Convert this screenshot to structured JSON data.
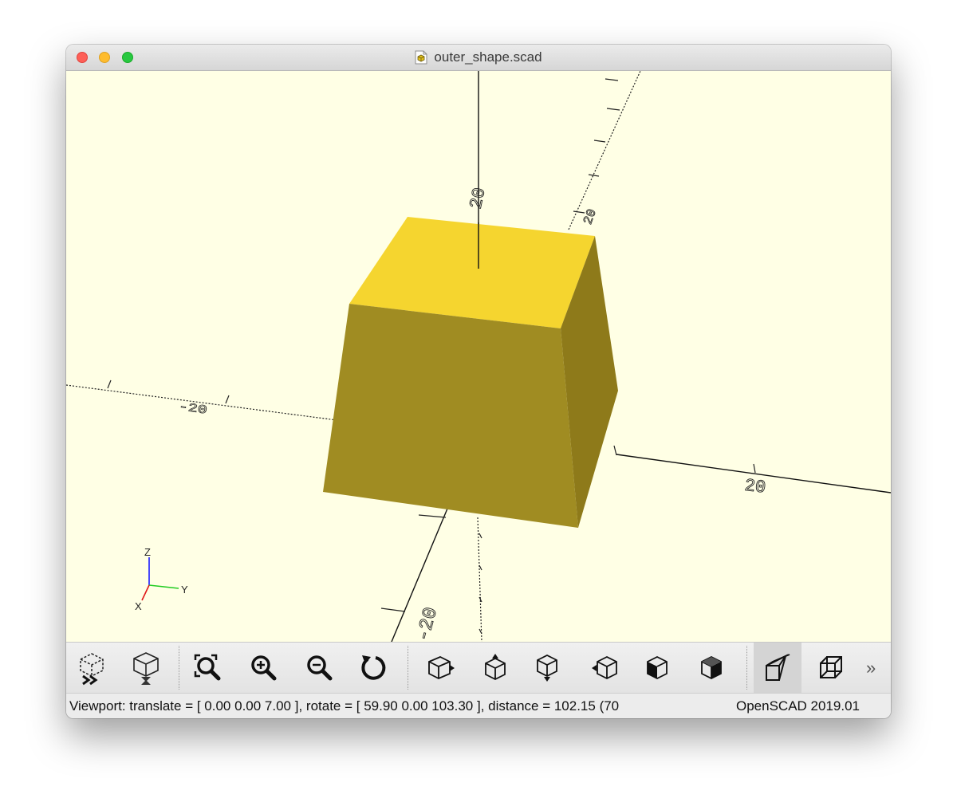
{
  "window": {
    "title": "outer_shape.scad"
  },
  "viewport": {
    "background_color": "#ffffe5",
    "object_colors": {
      "top": "#f5d52f",
      "front": "#a08c22",
      "side": "#8e7a1a"
    },
    "axis_labels": {
      "x_positive": "20",
      "x_negative": "-20",
      "y_positive": "20",
      "y_negative": "-20",
      "z_positive": "20"
    },
    "axes_indicator": {
      "z": "Z",
      "y": "Y",
      "x": "X"
    }
  },
  "toolbar": {
    "buttons": [
      {
        "name": "preview",
        "icon": "preview-icon"
      },
      {
        "name": "render",
        "icon": "render-icon"
      },
      {
        "name": "view-all",
        "icon": "zoom-fit-icon"
      },
      {
        "name": "zoom-in",
        "icon": "zoom-in-icon"
      },
      {
        "name": "zoom-out",
        "icon": "zoom-out-icon"
      },
      {
        "name": "reset-view",
        "icon": "reset-view-icon"
      },
      {
        "name": "view-right",
        "icon": "view-right-icon"
      },
      {
        "name": "view-top",
        "icon": "view-top-icon"
      },
      {
        "name": "view-bottom",
        "icon": "view-bottom-icon"
      },
      {
        "name": "view-left",
        "icon": "view-left-icon"
      },
      {
        "name": "view-front",
        "icon": "view-front-icon"
      },
      {
        "name": "view-back",
        "icon": "view-back-icon"
      },
      {
        "name": "perspective",
        "icon": "perspective-icon",
        "active": true
      },
      {
        "name": "orthogonal",
        "icon": "orthogonal-icon"
      }
    ],
    "more_label": "»"
  },
  "status": {
    "viewport_text": "Viewport: translate = [ 0.00 0.00 7.00 ], rotate = [ 59.90 0.00 103.30 ], distance = 102.15 (70",
    "app_version": "OpenSCAD 2019.01"
  }
}
